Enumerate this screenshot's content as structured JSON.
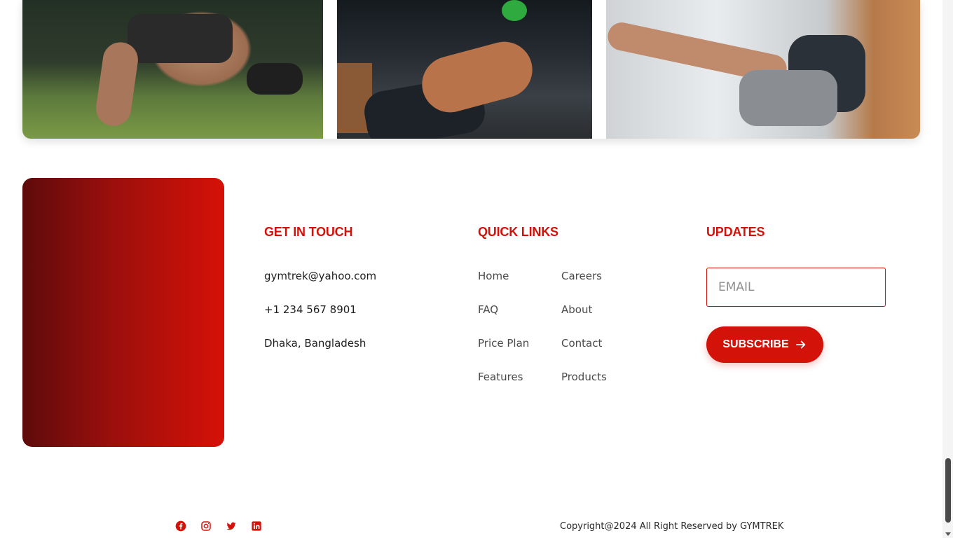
{
  "gallery": {
    "images": [
      {
        "alt": "man doing push-ups with weighted vest"
      },
      {
        "alt": "man swinging green kettlebell"
      },
      {
        "alt": "man doing hanging leg raise"
      }
    ]
  },
  "footer": {
    "contact": {
      "title": "GET IN TOUCH",
      "email": "gymtrek@yahoo.com",
      "phone": "+1 234 567 8901",
      "address": "Dhaka, Bangladesh"
    },
    "quick_links": {
      "title": "QUICK LINKS",
      "col1": [
        "Home",
        "FAQ",
        "Price Plan",
        "Features"
      ],
      "col2": [
        "Careers",
        "About",
        "Contact",
        "Products"
      ]
    },
    "updates": {
      "title": "UPDATES",
      "email_placeholder": "EMAIL",
      "subscribe_label": "SUBSCRIBE"
    },
    "social": [
      "facebook-icon",
      "instagram-icon",
      "twitter-icon",
      "linkedin-icon"
    ],
    "copyright": "Copyright@2024 All Right Reserved by GYMTREK"
  },
  "colors": {
    "accent": "#d3120a",
    "card_gradient_start": "#5e0b0b",
    "card_gradient_end": "#d51107"
  }
}
